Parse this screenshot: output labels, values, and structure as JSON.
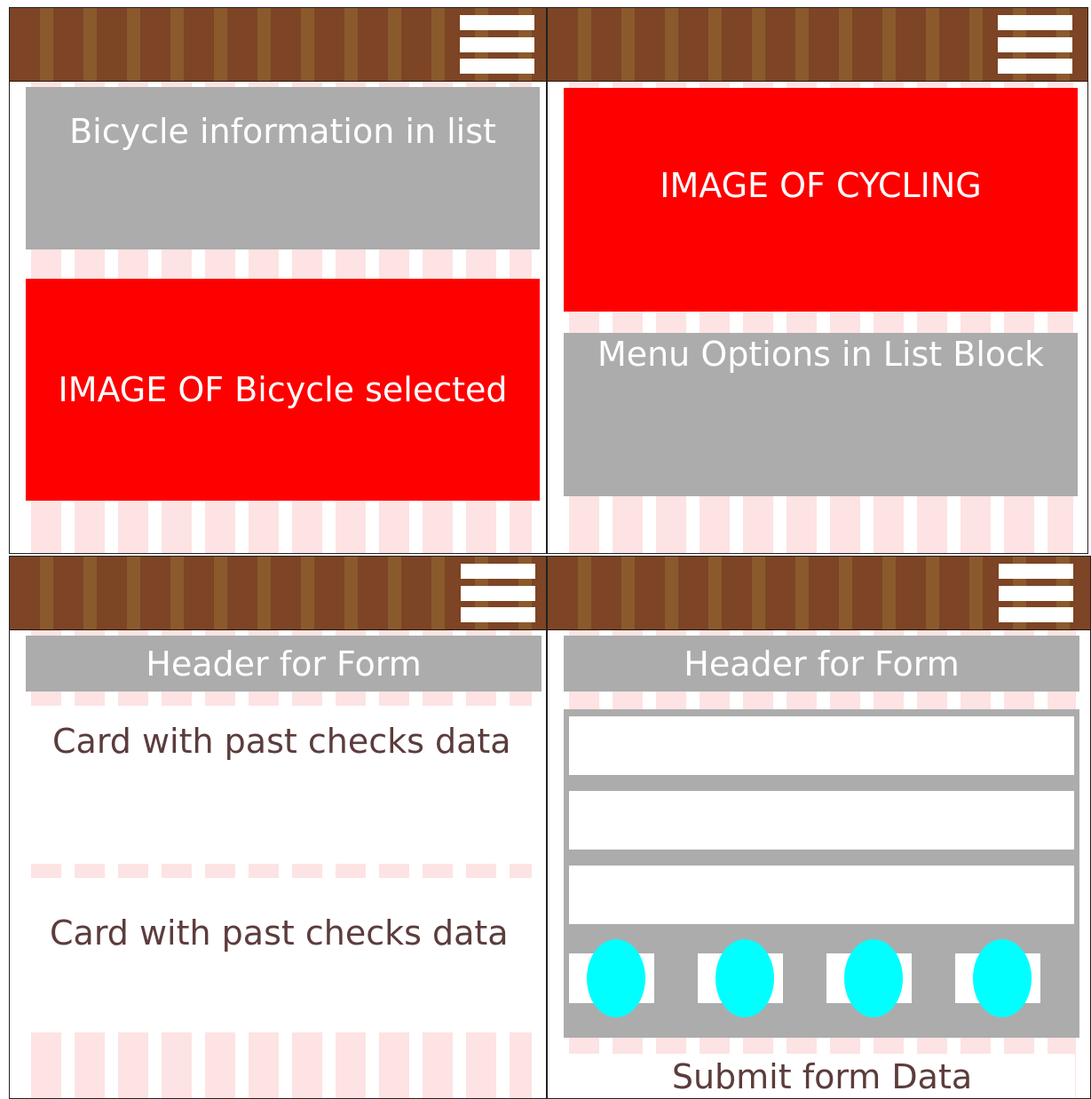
{
  "panel1": {
    "list_block": "Bicycle information in list",
    "image_block": "IMAGE OF Bicycle selected"
  },
  "panel2": {
    "image_block": "IMAGE OF CYCLING",
    "menu_block": "Menu Options in List Block"
  },
  "panel3": {
    "form_header": "Header for Form",
    "card_1": "Card with past checks data",
    "card_2": "Card with past checks data"
  },
  "panel4": {
    "form_header": "Header for Form",
    "submit": "Submit form Data"
  },
  "colors": {
    "topbar": "#7d4425",
    "gray_block": "#acacac",
    "image_block": "#ff0000",
    "radio": "#00ffff",
    "stripe": "#fde3e3"
  },
  "icons": [
    "hamburger-menu-icon"
  ]
}
